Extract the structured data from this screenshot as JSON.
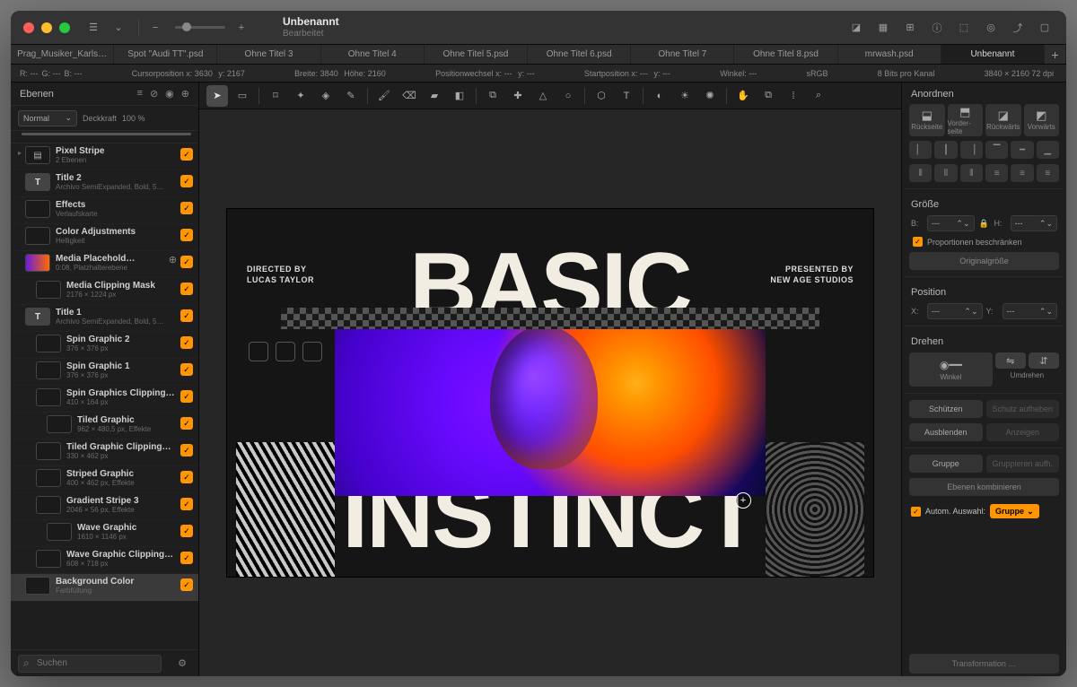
{
  "title": {
    "name": "Unbenannt",
    "status": "Bearbeitet"
  },
  "tabs": [
    {
      "label": "Prag_Musiker_Karls…"
    },
    {
      "label": "Spot \"Audi TT\".psd"
    },
    {
      "label": "Ohne Titel 3"
    },
    {
      "label": "Ohne Titel 4"
    },
    {
      "label": "Ohne Titel 5.psd"
    },
    {
      "label": "Ohne Titel 6.psd"
    },
    {
      "label": "Ohne Titel 7"
    },
    {
      "label": "Ohne Titel 8.psd"
    },
    {
      "label": "mrwash.psd"
    },
    {
      "label": "Unbenannt"
    }
  ],
  "info": {
    "r": "R: ---",
    "g": "G: ---",
    "b": "B: ---",
    "cursor": "Cursorposition x: 3630",
    "cursor_y": "y: 2167",
    "size_w": "Breite: 3840",
    "size_h": "Höhe: 2160",
    "posx": "Positionwechsel x: ---",
    "posy": "y: ---",
    "startx": "Startposition x: ---",
    "starty": "y: ---",
    "angle": "Winkel: ---",
    "cs": "sRGB",
    "bits": "8 Bits pro Kanal",
    "dim": "3840 × 2160 72 dpi"
  },
  "layers_panel": {
    "title": "Ebenen",
    "blend": "Normal",
    "opacity_label": "Deckkraft",
    "opacity_value": "100 %",
    "search_placeholder": "Suchen"
  },
  "layers": [
    {
      "name": "Pixel Stripe",
      "sub": "2 Ebenen",
      "type": "group",
      "indent": 0,
      "expand": true
    },
    {
      "name": "Title 2",
      "sub": "Archivo SemiExpanded, Bold, 5…",
      "type": "text",
      "indent": 0
    },
    {
      "name": "Effects",
      "sub": "Verlaufskarte",
      "type": "fx",
      "indent": 0
    },
    {
      "name": "Color Adjustments",
      "sub": "Helligkeit",
      "type": "adj",
      "indent": 0
    },
    {
      "name": "Media Placehold…",
      "sub": "0:08, Platzhalterebene",
      "type": "media",
      "indent": 0,
      "extra": true
    },
    {
      "name": "Media Clipping Mask",
      "sub": "2176 × 1224 px",
      "type": "mask",
      "indent": 1
    },
    {
      "name": "Title 1",
      "sub": "Archivo SemiExpanded, Bold, 5…",
      "type": "text",
      "indent": 0
    },
    {
      "name": "Spin Graphic 2",
      "sub": "376 × 376 px",
      "type": "img",
      "indent": 1
    },
    {
      "name": "Spin Graphic 1",
      "sub": "376 × 376 px",
      "type": "img",
      "indent": 1
    },
    {
      "name": "Spin Graphics Clipping…",
      "sub": "410 × 164 px",
      "type": "mask",
      "indent": 1
    },
    {
      "name": "Tiled Graphic",
      "sub": "962 × 480,5 px, Effekte",
      "type": "img",
      "indent": 2
    },
    {
      "name": "Tiled Graphic Clipping…",
      "sub": "330 × 462 px",
      "type": "mask",
      "indent": 1
    },
    {
      "name": "Striped Graphic",
      "sub": "400 × 462 px, Effekte",
      "type": "img",
      "indent": 1
    },
    {
      "name": "Gradient Stripe 3",
      "sub": "2046 × 56 px, Effekte",
      "type": "img",
      "indent": 1
    },
    {
      "name": "Wave Graphic",
      "sub": "1610 × 1146 px",
      "type": "img",
      "indent": 2
    },
    {
      "name": "Wave Graphic Clipping…",
      "sub": "608 × 718 px",
      "type": "mask",
      "indent": 1
    },
    {
      "name": "Background Color",
      "sub": "Farbfüllung",
      "type": "fill",
      "indent": 0,
      "selected": true
    }
  ],
  "canvas": {
    "headline1": "BASIC",
    "headline2": "INSTINCT",
    "caption_left_1": "DIRECTED BY",
    "caption_left_2": "LUCAS TAYLOR",
    "caption_right_1": "PRESENTED BY",
    "caption_right_2": "NEW AGE STUDIOS"
  },
  "right": {
    "arrange": "Anordnen",
    "to_back": "Rückseite",
    "to_front": "Vorder-\nseite",
    "backward": "Rückwärts",
    "forward": "Vorwärts",
    "size": "Größe",
    "w": "B:",
    "h": "H:",
    "constrain": "Proportionen beschränken",
    "original": "Originalgröße",
    "position": "Position",
    "x": "X:",
    "y": "Y:",
    "rotate": "Drehen",
    "angle": "Winkel",
    "flip": "Umdrehen",
    "protect": "Schützen",
    "unprotect": "Schutz aufheben",
    "hide": "Ausblenden",
    "show": "Anzeigen",
    "group": "Gruppe",
    "ungroup": "Gruppieren aufh.",
    "merge": "Ebenen kombinieren",
    "auto_select": "Autom. Auswahl:",
    "auto_target": "Gruppe",
    "transform": "Transformation …",
    "empty": "---"
  }
}
